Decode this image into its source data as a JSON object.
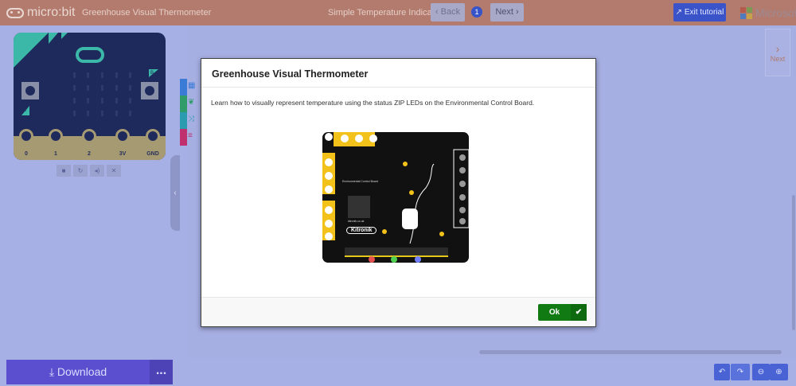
{
  "header": {
    "logo": "micro:bit",
    "project": "Greenhouse Visual Thermometer",
    "step_title": "Simple Temperature Indicator",
    "back": "Back",
    "step_number": "1",
    "next": "Next",
    "exit": "Exit tutorial",
    "brand": "Microsoft"
  },
  "simulator": {
    "pins": [
      "0",
      "1",
      "2",
      "3V",
      "GND"
    ],
    "button_a": "A",
    "button_b": "B",
    "controls": [
      "stop-icon",
      "restart-icon",
      "mute-icon",
      "fullscreen-icon"
    ]
  },
  "toolbox_colors": [
    "#3b7bd8",
    "#2f9c6a",
    "#2b9cb0",
    "#c0306e"
  ],
  "side": {
    "next": "Next"
  },
  "footer": {
    "download": "Download",
    "more": "..."
  },
  "modal": {
    "title": "Greenhouse Visual Thermometer",
    "body": "Learn how to visually represent temperature using the status ZIP LEDs on the Environmental Control Board.",
    "ok": "Ok",
    "board_label": "Environmental Control Board",
    "board_site": "kitronik.co.uk",
    "board_brand": "Kitronik"
  }
}
